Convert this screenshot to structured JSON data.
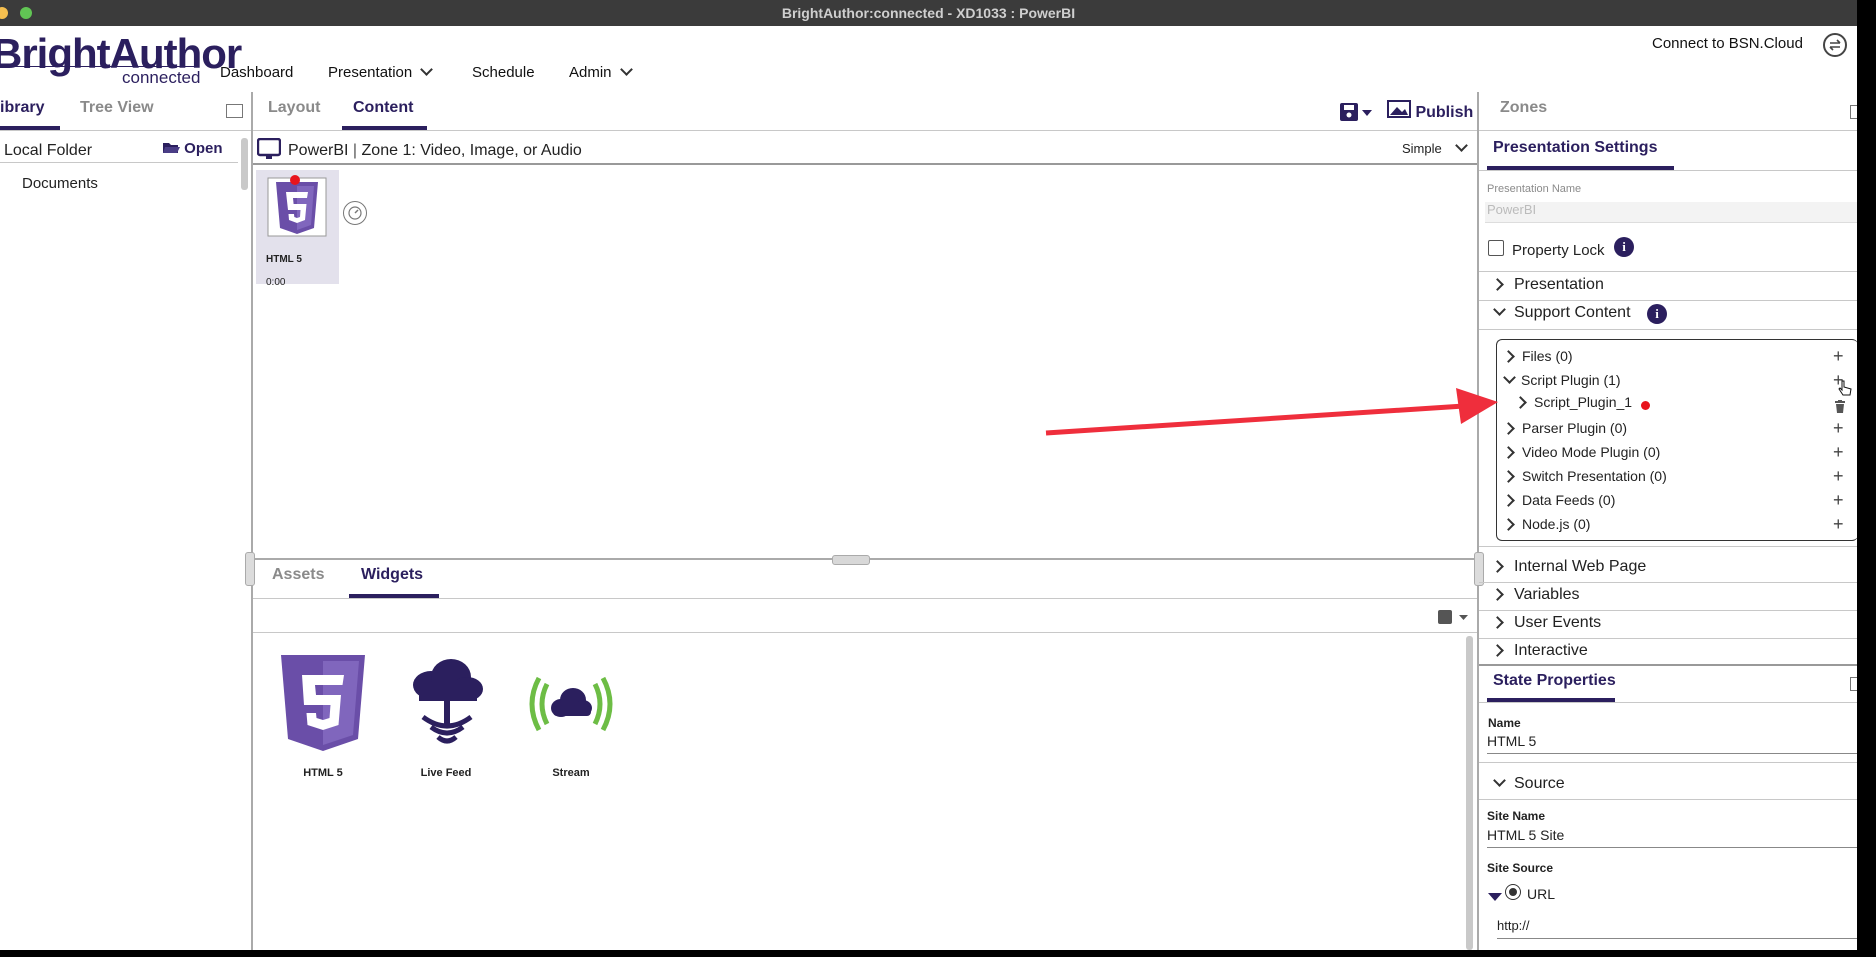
{
  "window": {
    "title": "BrightAuthor:connected - XD1033 : PowerBI"
  },
  "header": {
    "logo": "BrightAuthor",
    "logo_sub": "connected",
    "nav": [
      {
        "label": "Dashboard"
      },
      {
        "label": "Presentation"
      },
      {
        "label": "Schedule"
      },
      {
        "label": "Admin"
      }
    ],
    "connect_label": "Connect to BSN.Cloud"
  },
  "library": {
    "tabs": [
      "ibrary",
      "Tree View"
    ],
    "folder_label": "Local Folder",
    "open_label": "Open",
    "items": [
      "Documents"
    ]
  },
  "center": {
    "tabs": [
      "Layout",
      "Content"
    ],
    "publish_label": "Publish",
    "zone_title": "PowerBI",
    "zone_sub": "Zone 1: Video, Image, or Audio",
    "view_mode": "Simple",
    "state_item": {
      "label": "HTML 5",
      "time": "0:00"
    }
  },
  "bottom": {
    "tabs": [
      "Assets",
      "Widgets"
    ],
    "widgets": [
      {
        "label": "HTML 5",
        "icon": "html5-icon"
      },
      {
        "label": "Live Feed",
        "icon": "live-feed-icon"
      },
      {
        "label": "Stream",
        "icon": "stream-icon"
      }
    ]
  },
  "right": {
    "zones_tab": "Zones",
    "pres_settings_title": "Presentation Settings",
    "pres_name_label": "Presentation Name",
    "pres_name_value": "PowerBI",
    "property_lock": "Property Lock",
    "sections": {
      "presentation": "Presentation",
      "support_content": "Support Content",
      "internal_web_page": "Internal Web Page",
      "variables": "Variables",
      "user_events": "User Events",
      "interactive": "Interactive"
    },
    "support_items": [
      "Files (0)",
      "Script Plugin (1)",
      "Script_Plugin_1",
      "Parser Plugin (0)",
      "Video Mode Plugin (0)",
      "Switch Presentation (0)",
      "Data Feeds (0)",
      "Node.js (0)"
    ],
    "state_props_title": "State Properties",
    "name_label": "Name",
    "name_value": "HTML 5",
    "source_label": "Source",
    "site_name_label": "Site Name",
    "site_name_value": "HTML 5 Site",
    "site_source_label": "Site Source",
    "url_label": "URL",
    "url_value": "http://"
  },
  "colors": {
    "accent": "#2b1f5e",
    "arrow": "#ef2e3c",
    "stream_green": "#6dbd45"
  }
}
